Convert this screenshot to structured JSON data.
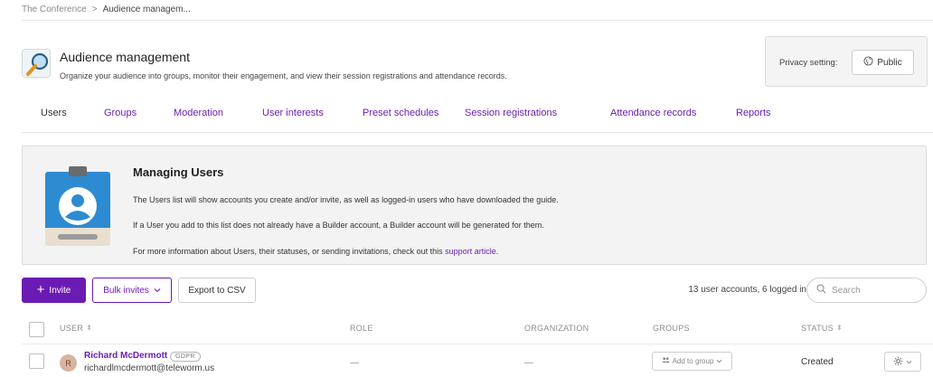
{
  "breadcrumb": {
    "root": "The Conference",
    "separator": ">",
    "current": "Audience managem..."
  },
  "header": {
    "title": "Audience management",
    "description": "Organize your audience into groups, monitor their engagement, and view their session registrations and attendance records.",
    "icon": "magnifier-icon"
  },
  "privacy": {
    "label": "Privacy setting:",
    "value": "Public",
    "icon": "globe-icon"
  },
  "tabs": [
    {
      "label": "Users",
      "active": true
    },
    {
      "label": "Groups",
      "active": false
    },
    {
      "label": "Moderation",
      "active": false
    },
    {
      "label": "User interests",
      "active": false
    },
    {
      "label": "Preset schedules",
      "active": false
    },
    {
      "label": "Session registrations",
      "active": false
    },
    {
      "label": "Attendance records",
      "active": false
    },
    {
      "label": "Reports",
      "active": false
    }
  ],
  "info": {
    "title": "Managing Users",
    "line1": "The Users list will show accounts you create and/or invite, as well as logged-in users who have downloaded the guide.",
    "line2": "If a User you add to this list does not already have a Builder account, a Builder account will be generated for them.",
    "line3_prefix": "For more information about Users, their statuses, or sending invitations, check out this ",
    "line3_link": "support article",
    "line3_suffix": "."
  },
  "toolbar": {
    "invite_label": "Invite",
    "bulk_label": "Bulk invites",
    "export_label": "Export to CSV",
    "count_text": "13 user accounts, 6 logged in",
    "search_placeholder": "Search"
  },
  "table": {
    "columns": {
      "user": "USER",
      "role": "ROLE",
      "organization": "ORGANIZATION",
      "groups": "GROUPS",
      "status": "STATUS"
    },
    "rows": [
      {
        "initial": "R",
        "name": "Richard McDermott",
        "badge": "GDPR",
        "email": "richardlmcdermott@teleworm.us",
        "role": "—",
        "organization": "—",
        "groups_action": "Add to group",
        "status": "Created"
      }
    ]
  },
  "colors": {
    "accent": "#6a1bb3",
    "link": "#6b1fb1",
    "panel_bg": "#f3f3f4"
  }
}
